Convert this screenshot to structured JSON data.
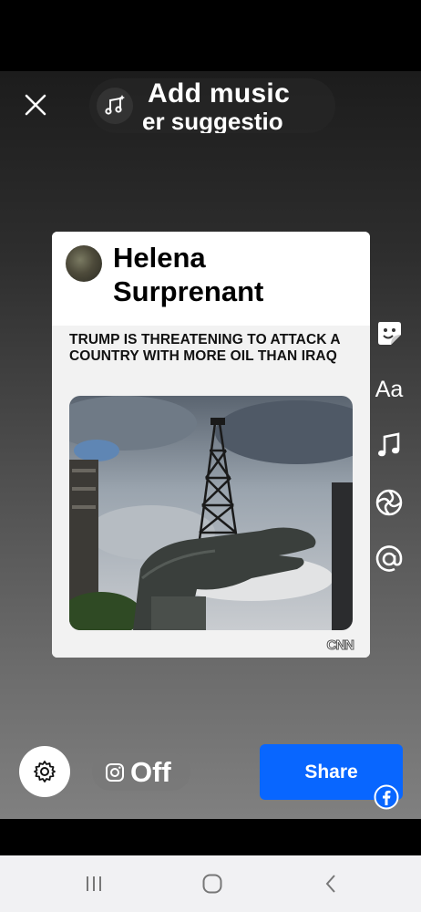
{
  "header": {
    "close_icon": "close-icon",
    "music_icon": "music-sparkle-icon",
    "music_title": "Add music",
    "music_subtitle": "er suggestio"
  },
  "card": {
    "author": "Helena Surprenant",
    "headline": "TRUMP IS THREATENING TO ATTACK A COUNTRY WITH MORE OIL THAN IRAQ",
    "source": "CNN"
  },
  "side_tools": [
    {
      "name": "sticker-icon"
    },
    {
      "name": "text-icon",
      "label": "Aa"
    },
    {
      "name": "music-note-icon"
    },
    {
      "name": "effects-icon"
    },
    {
      "name": "mention-icon"
    }
  ],
  "footer": {
    "settings_icon": "gear-icon",
    "instagram_icon": "instagram-icon",
    "instagram_toggle": "Off",
    "share_label": "Share",
    "share_color": "#0866ff",
    "facebook_icon": "facebook-icon"
  },
  "nav": {
    "recents": "recents-icon",
    "home": "home-icon",
    "back": "back-icon"
  }
}
